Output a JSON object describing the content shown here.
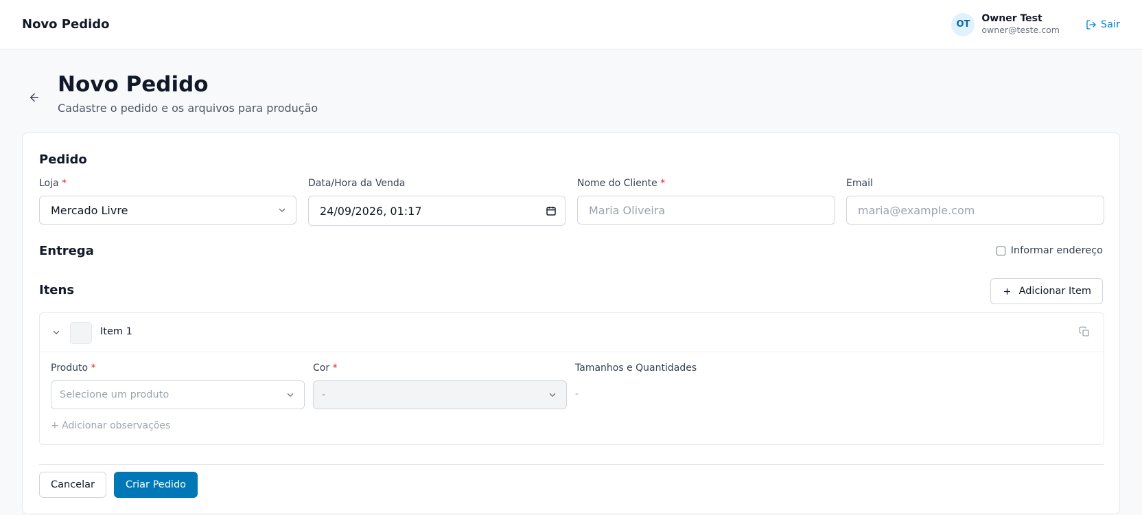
{
  "topbar": {
    "title": "Novo Pedido",
    "user": {
      "initials": "OT",
      "name": "Owner Test",
      "email": "owner@teste.com"
    },
    "logout_label": "Sair"
  },
  "header": {
    "title": "Novo Pedido",
    "subtitle": "Cadastre o pedido e os arquivos para produção"
  },
  "pedido": {
    "section_title": "Pedido",
    "loja": {
      "label": "Loja",
      "required": "*",
      "value": "Mercado Livre"
    },
    "data_hora": {
      "label": "Data/Hora da Venda",
      "value": "24/09/2026, 01:17"
    },
    "cliente": {
      "label": "Nome do Cliente",
      "required": "*",
      "placeholder": "Maria Oliveira"
    },
    "email": {
      "label": "Email",
      "placeholder": "maria@example.com"
    }
  },
  "entrega": {
    "section_title": "Entrega",
    "checkbox_label": "Informar endereço",
    "checked": false
  },
  "itens": {
    "section_title": "Itens",
    "add_button_label": "Adicionar Item",
    "items": [
      {
        "name": "Item 1",
        "produto": {
          "label": "Produto",
          "required": "*",
          "placeholder": "Selecione um produto"
        },
        "cor": {
          "label": "Cor",
          "required": "*",
          "value": "-"
        },
        "tamanhos": {
          "label": "Tamanhos e Quantidades",
          "value": "-"
        },
        "add_notes_label": "+ Adicionar observações"
      }
    ]
  },
  "actions": {
    "cancel_label": "Cancelar",
    "submit_label": "Criar Pedido"
  },
  "colors": {
    "primary": "#0077b6",
    "link": "#0284c7",
    "required": "#dc2626"
  }
}
